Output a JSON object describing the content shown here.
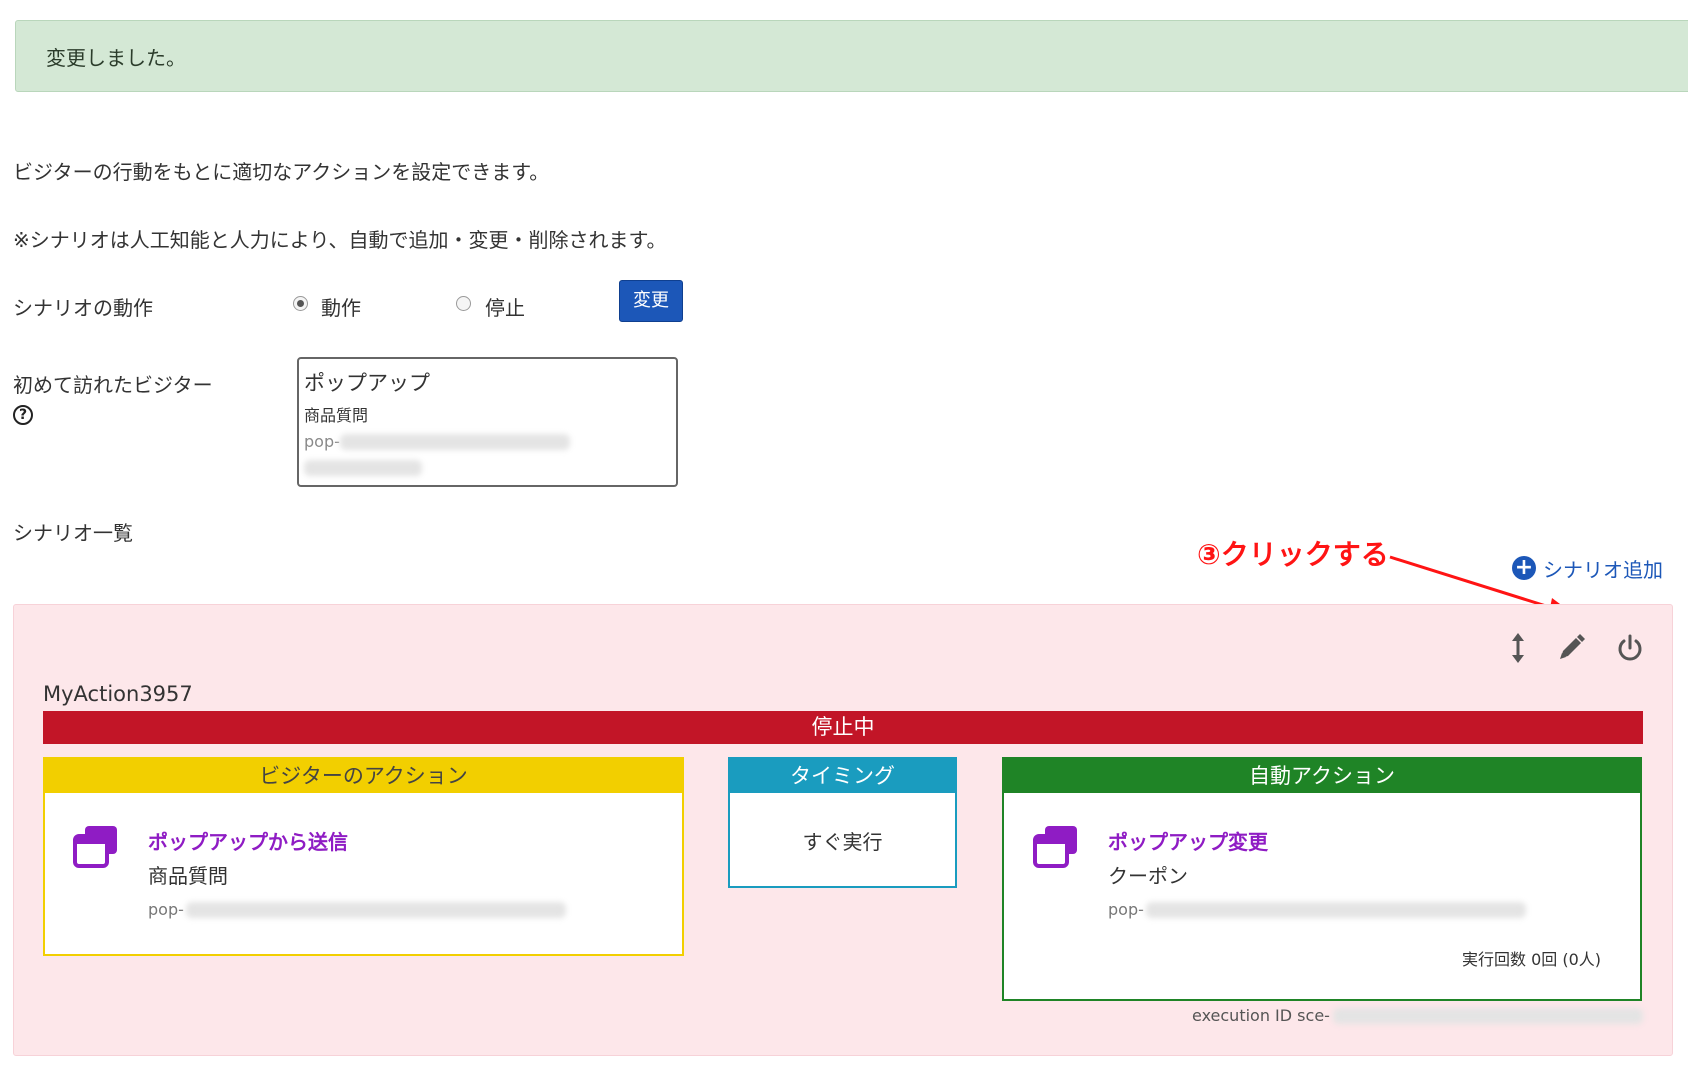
{
  "alert": {
    "text": "変更しました。"
  },
  "intro": {
    "line1": "ビジターの行動をもとに適切なアクションを設定できます。",
    "line2": "※シナリオは人工知能と人力により、自動で追加・変更・削除されます。"
  },
  "scenario_operation": {
    "label": "シナリオの動作",
    "options": [
      "動作",
      "停止"
    ],
    "selected": "動作",
    "change_button": "変更"
  },
  "first_visitor": {
    "label": "初めて訪れたビジター",
    "help_icon": "question-circle-icon",
    "box_title": "ポップアップ",
    "box_subtitle": "商品質問",
    "box_id_prefix": "pop-"
  },
  "scenario_list": {
    "label": "シナリオ一覧",
    "add_link": "シナリオ追加",
    "annotation": "③クリックする"
  },
  "action_card": {
    "name": "MyAction3957",
    "status": "停止中",
    "visitor_action": {
      "header": "ビジターのアクション",
      "title": "ポップアップから送信",
      "subtitle": "商品質問",
      "id_prefix": "pop-"
    },
    "timing": {
      "header": "タイミング",
      "value": "すぐ実行"
    },
    "auto_action": {
      "header": "自動アクション",
      "title": "ポップアップ変更",
      "subtitle": "クーポン",
      "id_prefix": "pop-",
      "count_text": "実行回数 0回 (0人)"
    },
    "execution_id_prefix": "execution ID sce-"
  },
  "colors": {
    "alert_bg": "#d4e8d5",
    "primary": "#1c57b8",
    "stop_red": "#c21527",
    "panel_pink": "#fde7ea",
    "visitor_yellow": "#f2cf00",
    "timing_teal": "#1a9cbf",
    "auto_green": "#1f8426",
    "purple": "#8f1cc4",
    "annotation_red": "#ff1414"
  }
}
